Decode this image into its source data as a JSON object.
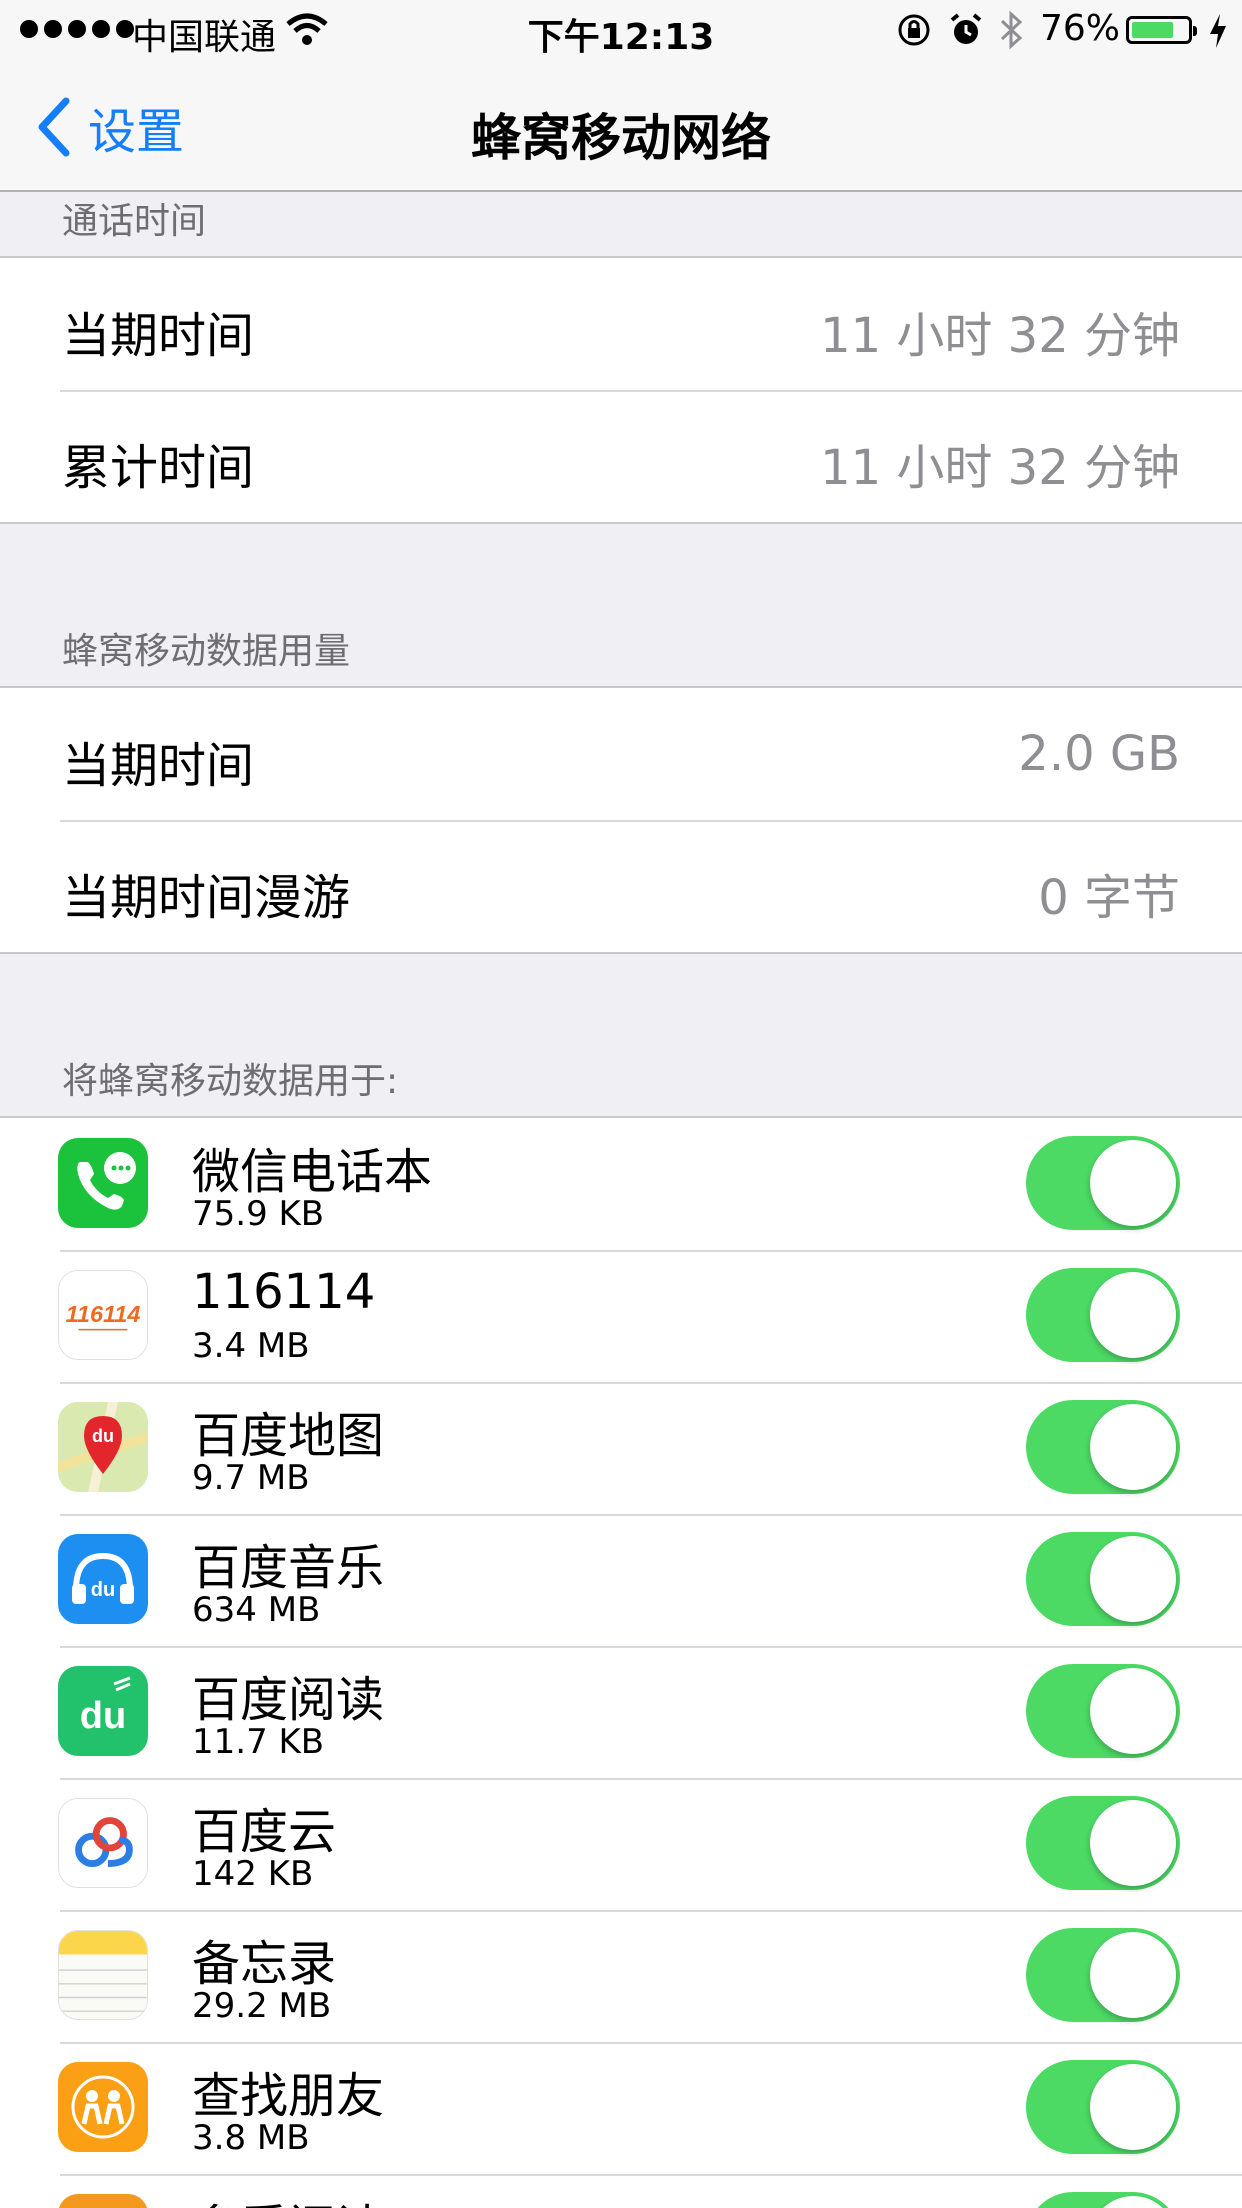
{
  "status_bar": {
    "carrier": "中国联通",
    "time": "下午12:13",
    "battery_percent": "76%",
    "battery_level": 0.76,
    "battery_color": "#4cd964",
    "icons": [
      "signal-dots-icon",
      "wifi-icon",
      "rotation-lock-icon",
      "alarm-icon",
      "bluetooth-icon",
      "battery-icon",
      "charging-icon"
    ]
  },
  "nav": {
    "back_label": "设置",
    "title": "蜂窝移动网络",
    "accent_color": "#157efb"
  },
  "call_time": {
    "header": "通话时间",
    "rows": [
      {
        "label": "当期时间",
        "value": "11 小时 32 分钟"
      },
      {
        "label": "累计时间",
        "value": "11 小时 32 分钟"
      }
    ]
  },
  "data_usage": {
    "header": "蜂窝移动数据用量",
    "rows": [
      {
        "label": "当期时间",
        "value": "2.0 GB"
      },
      {
        "label": "当期时间漫游",
        "value": "0 字节"
      }
    ]
  },
  "apps": {
    "header": "将蜂窝移动数据用于:",
    "toggle_on_color": "#4cd964",
    "items": [
      {
        "name": "微信电话本",
        "size": "75.9 KB",
        "enabled": true,
        "icon": "wechat-phonebook-icon"
      },
      {
        "name": "116114",
        "size": "3.4 MB",
        "enabled": true,
        "icon": "116114-icon"
      },
      {
        "name": "百度地图",
        "size": "9.7 MB",
        "enabled": true,
        "icon": "baidu-map-icon"
      },
      {
        "name": "百度音乐",
        "size": "634 MB",
        "enabled": true,
        "icon": "baidu-music-icon"
      },
      {
        "name": "百度阅读",
        "size": "11.7 KB",
        "enabled": true,
        "icon": "baidu-reader-icon"
      },
      {
        "name": "百度云",
        "size": "142 KB",
        "enabled": true,
        "icon": "baidu-cloud-icon"
      },
      {
        "name": "备忘录",
        "size": "29.2 MB",
        "enabled": true,
        "icon": "notes-icon"
      },
      {
        "name": "查找朋友",
        "size": "3.8 MB",
        "enabled": true,
        "icon": "find-friends-icon"
      },
      {
        "name": "多看阅读",
        "size": "",
        "enabled": true,
        "icon": "duokan-reader-icon"
      }
    ]
  }
}
